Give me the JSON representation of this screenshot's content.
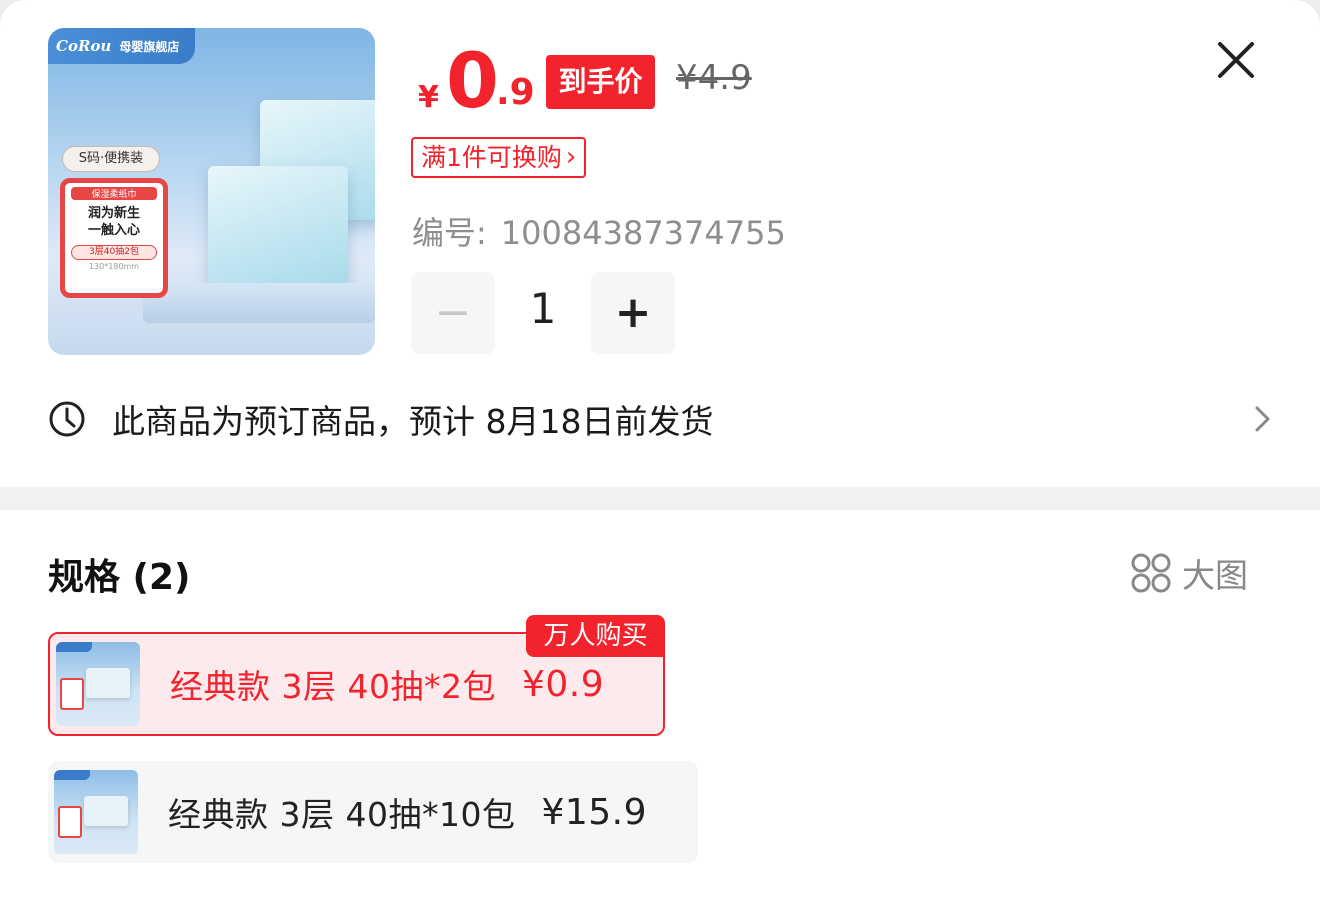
{
  "product": {
    "image_brand_logo": "CoRou",
    "image_brand_sub": "母婴旗舰店",
    "image_tag_size": "S码·便携装",
    "image_card_sub": "保湿柔纸巾",
    "image_card_main_1": "润为新生",
    "image_card_main_2": "一触入心",
    "image_card_pack": "3层40抽2包",
    "image_card_size": "130*180mm"
  },
  "price": {
    "currency": "¥",
    "integer": "0",
    "decimal": ".9",
    "tag": "到手价",
    "original": "¥4.9"
  },
  "promo": {
    "label": "满1件可换购",
    "chevron": "›"
  },
  "sku": {
    "label": "编号:",
    "value": "10084387374755"
  },
  "quantity": {
    "minus": "−",
    "value": "1",
    "plus": "+"
  },
  "preorder": {
    "text": "此商品为预订商品，预计 8月18日前发货"
  },
  "spec": {
    "title": "规格 (2)",
    "toggle_label": "大图",
    "badge": "万人购买",
    "options": [
      {
        "name": "经典款 3层 40抽*2包",
        "price": "¥0.9",
        "selected": true
      },
      {
        "name": "经典款 3层 40抽*10包",
        "price": "¥15.9",
        "selected": false
      }
    ]
  },
  "colors": {
    "accent": "#f2232c",
    "selected_bg": "#fdeaec",
    "option_bg": "#f5f6f8"
  },
  "icons": [
    "close-icon",
    "clock-icon",
    "chevron-right-icon",
    "grid-icon"
  ]
}
